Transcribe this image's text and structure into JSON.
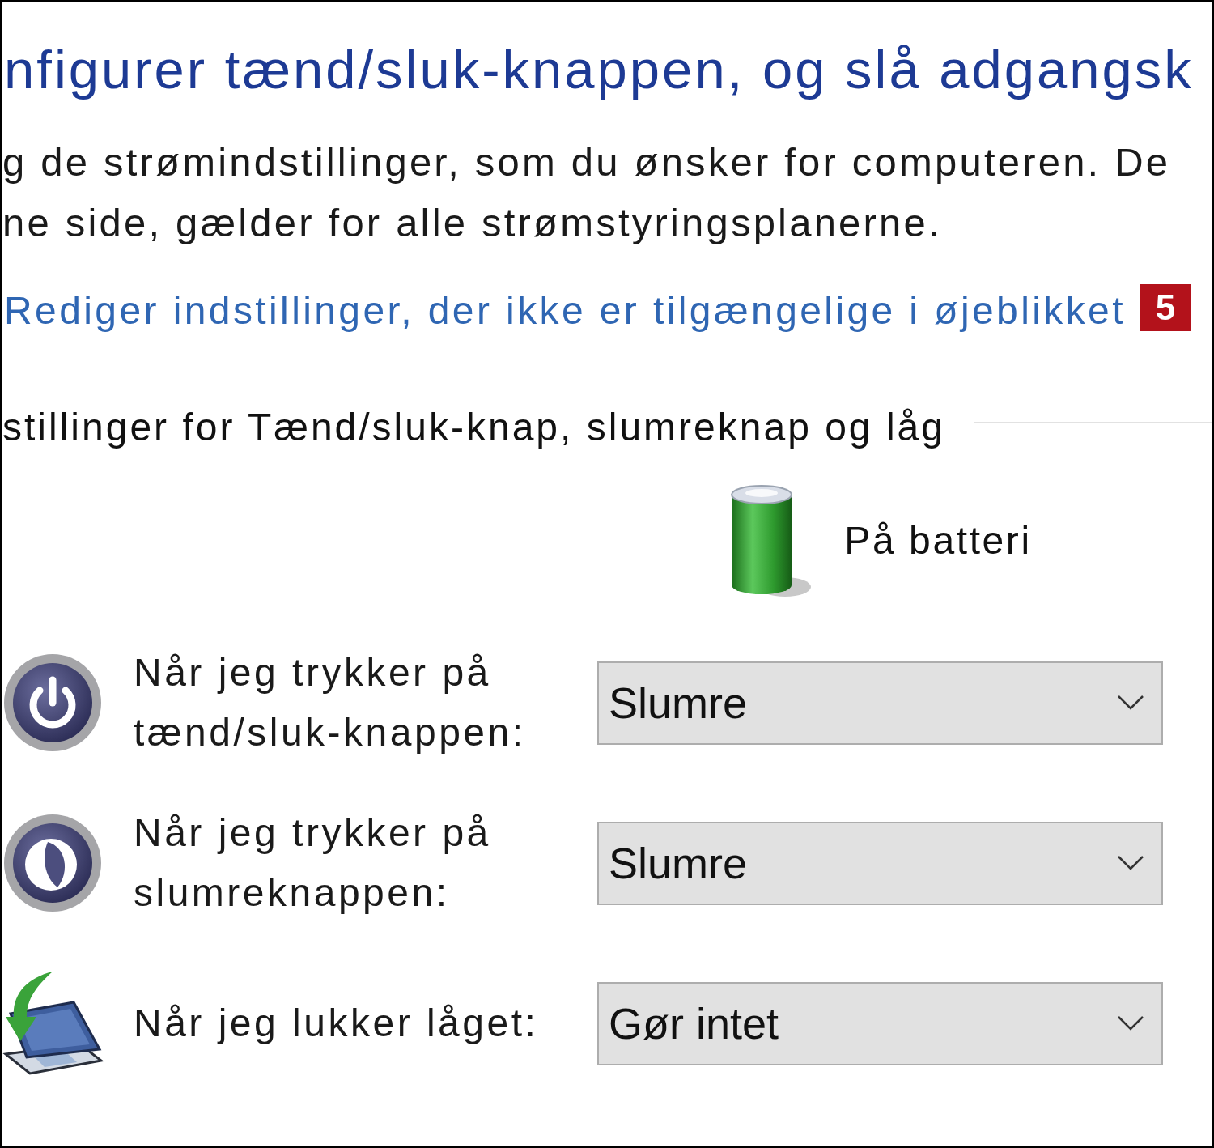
{
  "page": {
    "title": "nfigurer tænd/sluk-knappen, og slå adgangsk",
    "description_lines": [
      "g de strømindstillinger, som du ønsker for computeren. De",
      "ne side, gælder for alle strømstyringsplanerne."
    ],
    "link": {
      "text": "Rediger indstillinger, der ikke er tilgængelige i øjeblikket",
      "badge": "5"
    }
  },
  "section": {
    "title": "stillinger for Tænd/sluk-knap, slumreknap og låg",
    "column_header": "På batteri",
    "settings": [
      {
        "kind": "power",
        "label": "Når jeg trykker på tænd/sluk-knappen:",
        "value": "Slumre"
      },
      {
        "kind": "sleep",
        "label": "Når jeg trykker på slumreknappen:",
        "value": "Slumre"
      },
      {
        "kind": "lid",
        "label": "Når jeg lukker låget:",
        "value": "Gør intet"
      }
    ]
  }
}
